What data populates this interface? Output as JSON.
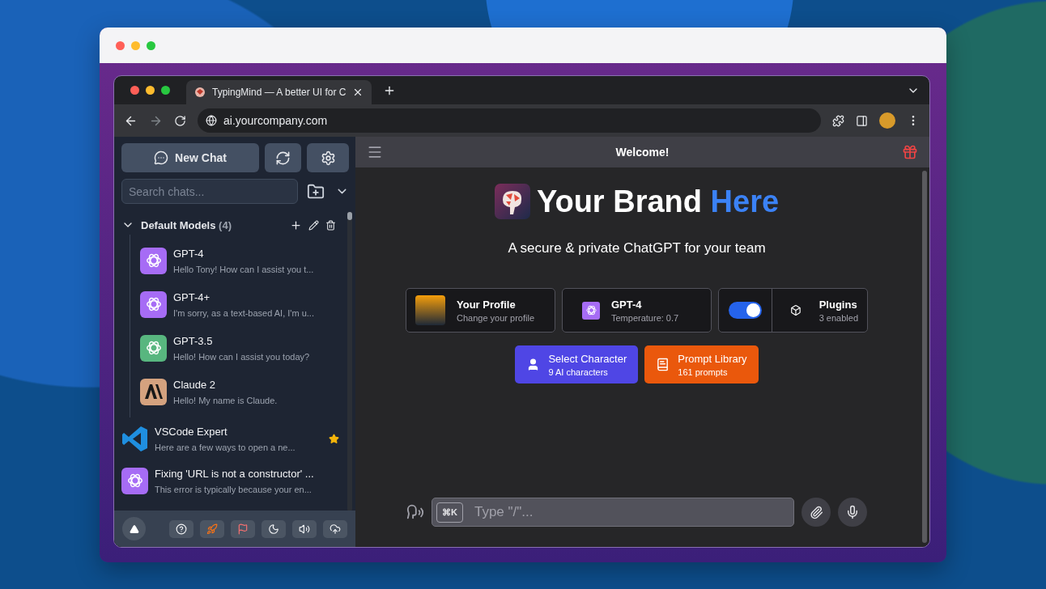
{
  "browser": {
    "tab_title": "TypingMind — A better UI for C",
    "url": "ai.yourcompany.com"
  },
  "sidebar": {
    "new_chat": "New Chat",
    "search": {
      "placeholder": "Search chats..."
    },
    "folder": {
      "name": "Default Models",
      "count": "(4)",
      "expanded": true,
      "chats": [
        {
          "title": "GPT-4",
          "preview": "Hello Tony! How can I assist you t...",
          "kind": "openai",
          "color": "#a66cf5"
        },
        {
          "title": "GPT-4+",
          "preview": "I'm sorry, as a text-based AI, I'm u...",
          "kind": "openai",
          "color": "#a66cf5"
        },
        {
          "title": "GPT-3.5",
          "preview": "Hello! How can I assist you today?",
          "kind": "openai",
          "color": "#58b67f"
        },
        {
          "title": "Claude 2",
          "preview": "Hello! My name is Claude.",
          "kind": "anthropic",
          "color": "#d4a27f"
        }
      ]
    },
    "chats": [
      {
        "title": "VSCode Expert",
        "preview": "Here are a few ways to open a ne...",
        "kind": "vscode",
        "starred": true
      },
      {
        "title": "Fixing 'URL is not a constructor' ...",
        "preview": "This error is typically because your en...",
        "kind": "openai",
        "starred": false
      }
    ]
  },
  "main": {
    "header_title": "Welcome!",
    "brand": {
      "name": "Your Brand",
      "highlight": "Here"
    },
    "tagline": "A secure & private ChatGPT for your team",
    "profile": {
      "title": "Your Profile",
      "subtitle": "Change your profile"
    },
    "model": {
      "title": "GPT-4",
      "subtitle": "Temperature: 0.7"
    },
    "plugins": {
      "on": true,
      "title": "Plugins",
      "subtitle": "3 enabled"
    },
    "actions": [
      {
        "kind": "character",
        "title": "Select Character",
        "subtitle": "9 AI characters",
        "color": "#4f46e5"
      },
      {
        "kind": "library",
        "title": "Prompt Library",
        "subtitle": "161 prompts",
        "color": "#ea580c"
      }
    ],
    "composer": {
      "shortcut": "⌘K",
      "placeholder": "Type \"/\"..."
    }
  }
}
